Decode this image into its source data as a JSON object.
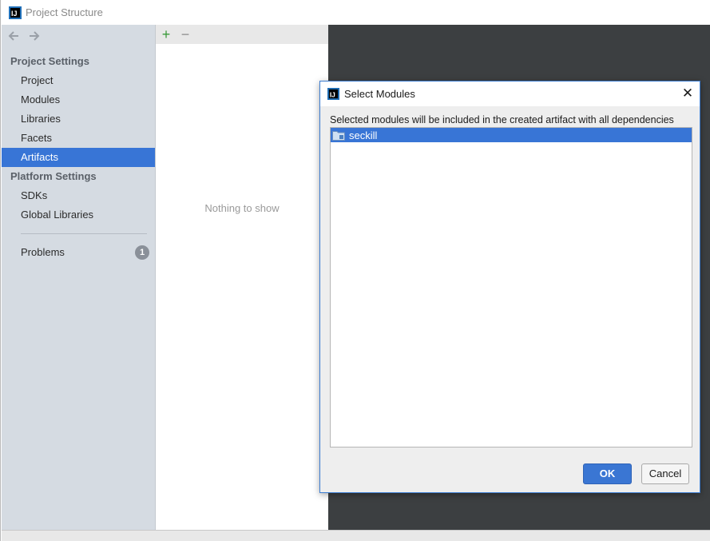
{
  "window": {
    "title": "Project Structure"
  },
  "sidebar": {
    "project_settings_header": "Project Settings",
    "project_settings_items": [
      {
        "label": "Project"
      },
      {
        "label": "Modules"
      },
      {
        "label": "Libraries"
      },
      {
        "label": "Facets"
      },
      {
        "label": "Artifacts",
        "selected": true
      }
    ],
    "platform_settings_header": "Platform Settings",
    "platform_settings_items": [
      {
        "label": "SDKs"
      },
      {
        "label": "Global Libraries"
      }
    ],
    "problems": {
      "label": "Problems",
      "count": "1"
    }
  },
  "middle": {
    "toolbar": {
      "add_icon": "plus-icon",
      "remove_icon": "minus-icon"
    },
    "empty_text": "Nothing to show"
  },
  "dialog": {
    "title": "Select Modules",
    "description": "Selected modules will be included in the created artifact with all dependencies",
    "modules": [
      {
        "label": "seckill",
        "icon": "module-folder-icon",
        "selected": true
      }
    ],
    "ok_label": "OK",
    "cancel_label": "Cancel"
  },
  "colors": {
    "selection": "#3875d6",
    "sidebar_bg": "#d5dbe2",
    "dark_panel": "#3c3f41",
    "add_green": "#3a9a3a"
  }
}
